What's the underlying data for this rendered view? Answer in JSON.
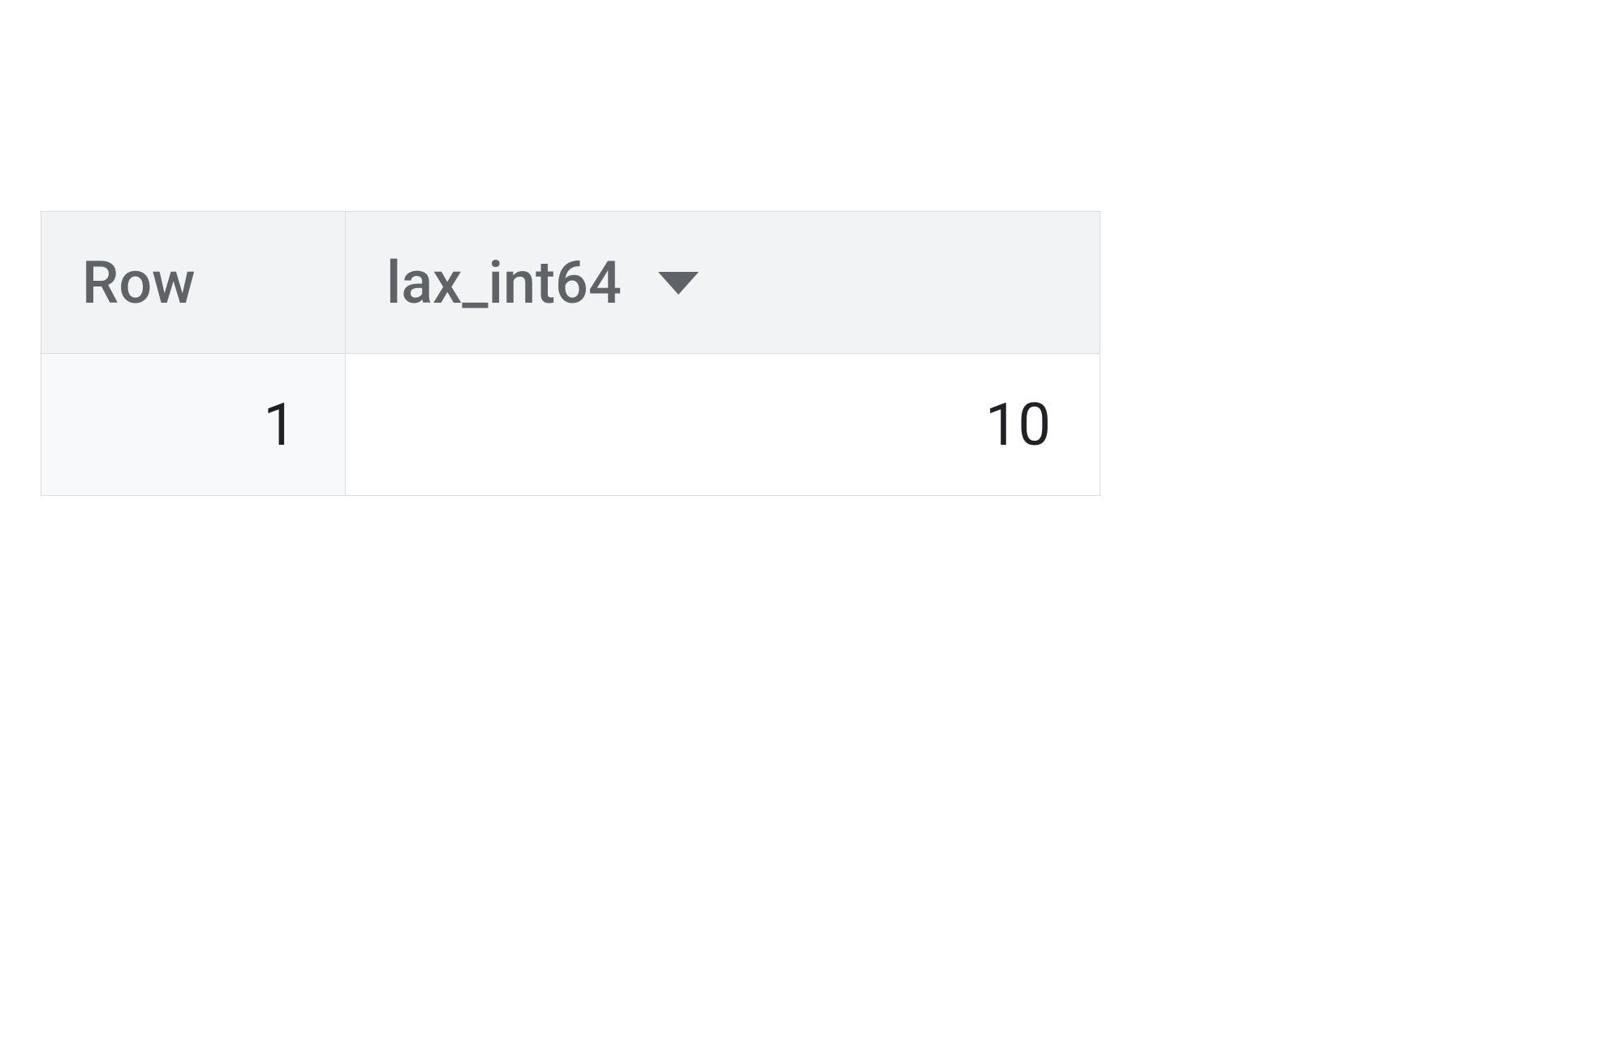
{
  "table": {
    "columns": [
      {
        "label": "Row"
      },
      {
        "label": "lax_int64"
      }
    ],
    "rows": [
      {
        "row_number": "1",
        "lax_int64": "10"
      }
    ]
  }
}
